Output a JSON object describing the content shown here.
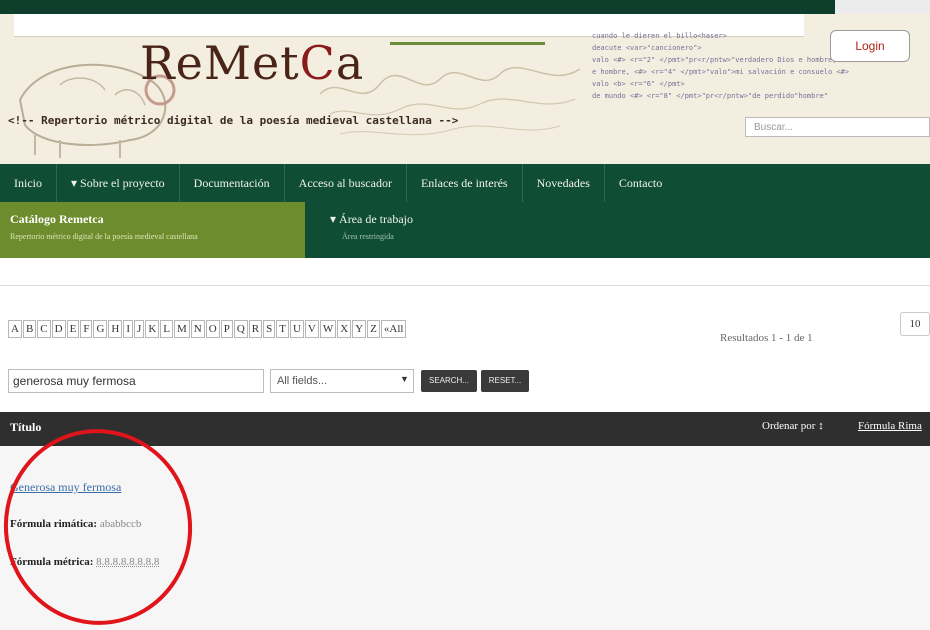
{
  "header": {
    "logo_text": "ReMetCa",
    "comment_line": "<!-- Repertorio métrico digital de la poesía medieval castellana -->",
    "login_label": "Login",
    "search_placeholder": "Buscar...",
    "code_lines": [
      "cuando le dieren el billo<haser>",
      "deacute <var>\"cancionero\">",
      "valo <#> <r=\"2\" </pmt>\"pr<r/pntw>\"verdadero Dios e hombre, <#>",
      "e hombre, <#> <r=\"4\" </pmt>\"valo\">mi salvación e consuelo <#>",
      "valo <b> <r=\"6\" </pmt>",
      "de mundo <#> <r=\"8\" </pmt>\"pr<r/pntw>\"de perdido\"hombre\""
    ]
  },
  "nav": {
    "items": [
      "Inicio",
      "▾ Sobre el proyecto",
      "Documentación",
      "Acceso al buscador",
      "Enlaces de interés",
      "Novedades",
      "Contacto"
    ],
    "catalog_title": "Catálogo Remetca",
    "catalog_subtitle": "Repertorio métrico digital de la poesía medieval castellana",
    "work_title": "▾ Área de trabajo",
    "work_subtitle": "Área restringida"
  },
  "alphabet": [
    "A",
    "B",
    "C",
    "D",
    "E",
    "F",
    "G",
    "H",
    "I",
    "J",
    "K",
    "L",
    "M",
    "N",
    "O",
    "P",
    "Q",
    "R",
    "S",
    "T",
    "U",
    "V",
    "W",
    "X",
    "Y",
    "Z",
    "«All"
  ],
  "results_summary": "Resultados 1 - 1 de 1",
  "per_page": "10",
  "search": {
    "query": "generosa muy fermosa",
    "field": "All fields...",
    "search_label": "SEARCH...",
    "reset_label": "RESET..."
  },
  "table_header": {
    "title": "Título",
    "order_by": "Ordenar por ↕",
    "order_field": "Fórmula Rima"
  },
  "result": {
    "title": "Generosa muy fermosa",
    "rima_label": "Fórmula rimática:",
    "rima_value": "ababbccb",
    "metrica_label": "Fórmula métrica:",
    "metrica_value": "8.8.8.8.8.8.8.8"
  },
  "colors": {
    "nav_green": "#0f4d35",
    "catalog_green": "#6d8c2b",
    "header_dark": "#2f2f2f",
    "annotation_red": "#e0141b"
  }
}
